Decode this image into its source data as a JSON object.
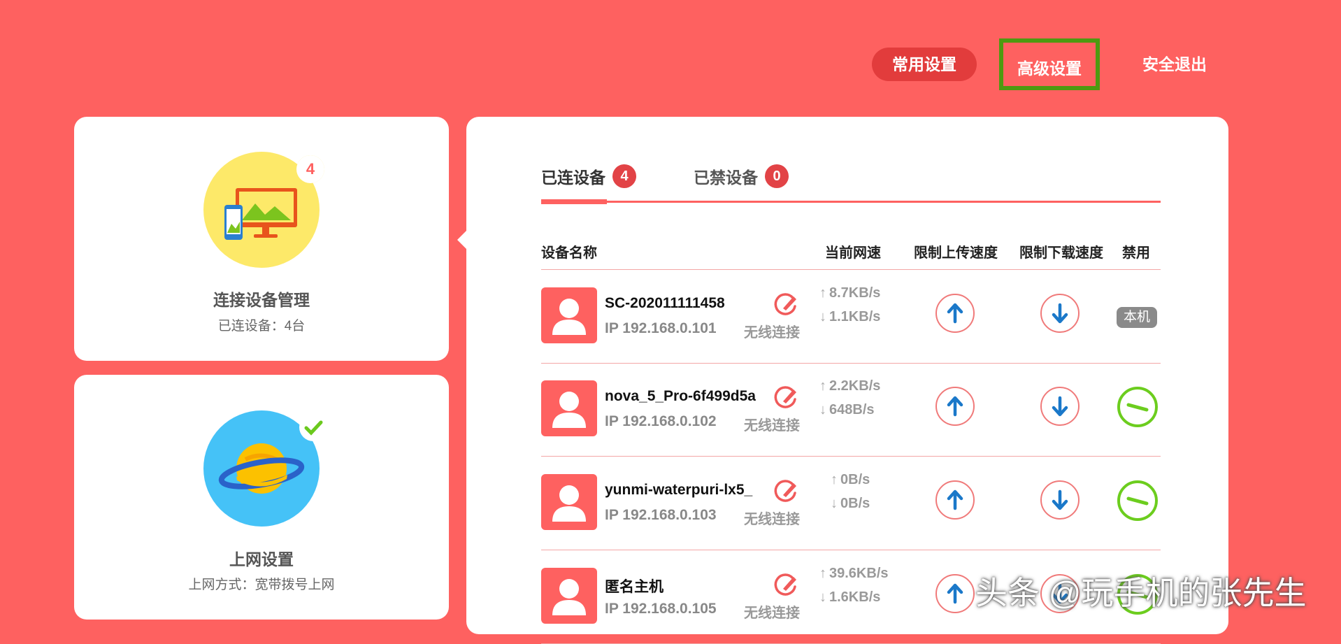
{
  "nav": {
    "common_settings": "常用设置",
    "advanced_settings": "高级设置",
    "logout": "安全退出"
  },
  "cards": {
    "devices": {
      "badge": "4",
      "title": "连接设备管理",
      "subtitle": "已连设备：4台"
    },
    "internet": {
      "badge_icon": "check-icon",
      "title": "上网设置",
      "subtitle": "上网方式：宽带拨号上网"
    }
  },
  "tabs": [
    {
      "label": "已连设备",
      "count": "4"
    },
    {
      "label": "已禁设备",
      "count": "0"
    }
  ],
  "table": {
    "headers": {
      "name": "设备名称",
      "speed": "当前网速",
      "limit_up": "限制上传速度",
      "limit_down": "限制下载速度",
      "ban": "禁用"
    },
    "rows": [
      {
        "name": "SC-202011111458",
        "ip": "IP 192.168.0.101",
        "conn": "无线连接",
        "up": "8.7KB/s",
        "down": "1.1KB/s",
        "self_tag": "本机"
      },
      {
        "name": "nova_5_Pro-6f499d5a",
        "ip": "IP 192.168.0.102",
        "conn": "无线连接",
        "up": "2.2KB/s",
        "down": "648B/s"
      },
      {
        "name": "yunmi-waterpuri-lx5_",
        "ip": "IP 192.168.0.103",
        "conn": "无线连接",
        "up": "0B/s",
        "down": "0B/s"
      },
      {
        "name": "匿名主机",
        "ip": "IP 192.168.0.105",
        "conn": "无线连接",
        "up": "39.6KB/s",
        "down": "1.6KB/s"
      }
    ]
  },
  "watermark": "头条 @玩手机的张先生",
  "colors": {
    "background": "#fe6160",
    "accent_dark": "#e23c3c",
    "highlight_border": "#4e9a10",
    "ban_green": "#6ccd1e",
    "arrow_blue": "#1a78c9"
  }
}
